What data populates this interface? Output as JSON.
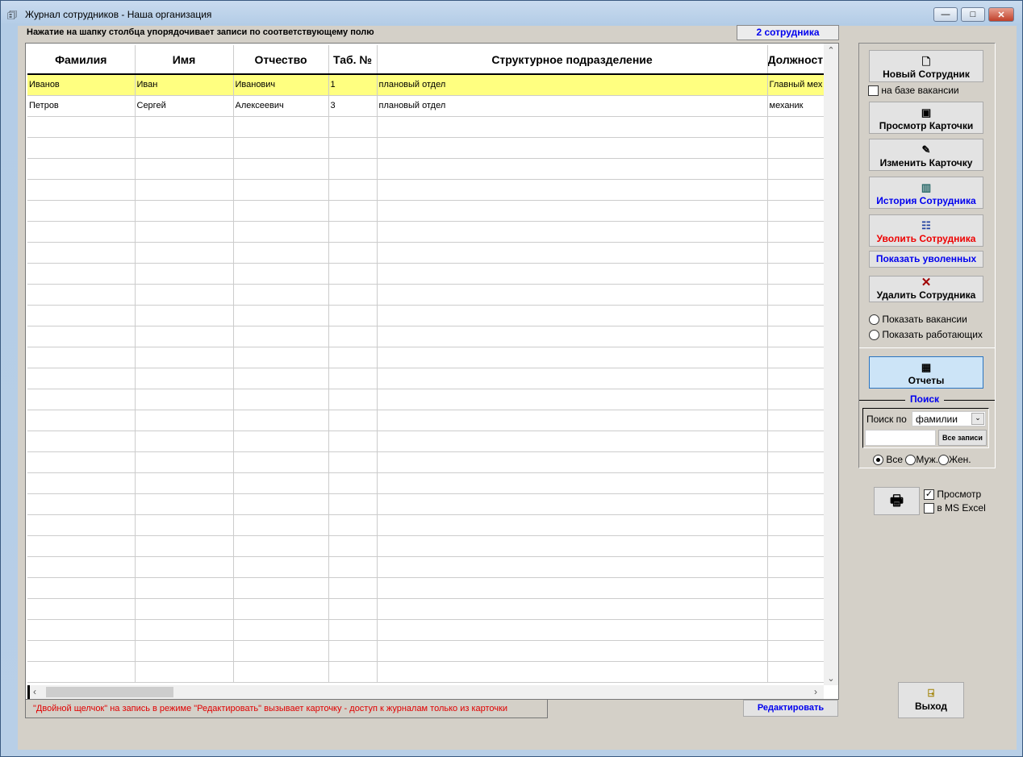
{
  "window": {
    "title": "Журнал сотрудников -  Наша организация",
    "min": "—",
    "max": "□",
    "close": "✕"
  },
  "hint": "Нажатие на шапку столбца упорядочивает записи  по соответствующему полю",
  "count": "2 сотрудника",
  "table": {
    "columns": [
      "Фамилия",
      "Имя",
      "Отчество",
      "Таб. №",
      "Структурное подразделение",
      "Должност"
    ],
    "rows": [
      [
        "Иванов",
        "Иван",
        "Иванович",
        "1",
        "плановый отдел",
        "Главный мех"
      ],
      [
        "Петров",
        "Сергей",
        "Алексеевич",
        "3",
        "плановый отдел",
        "механик"
      ]
    ],
    "selected_row": 0
  },
  "status": "\"Двойной щелчок\" на запись в режиме \"Редактировать\" вызывает карточку  -  доступ к журналам только из карточки",
  "edit_button": "Редактировать",
  "exit_button": "Выход",
  "panel": {
    "new_employee": "Новый Сотрудник",
    "from_vacancy": "на базе вакансии",
    "view_card": "Просмотр Карточки",
    "edit_card": "Изменить Карточку",
    "history": "История Сотрудника",
    "dismiss": "Уволить Сотрудника",
    "show_dismissed": "Показать уволенных",
    "delete": "Удалить Сотрудника",
    "show_vacancies": "Показать вакансии",
    "show_working": "Показать работающих",
    "reports": "Отчеты",
    "search": {
      "title": "Поиск",
      "by_label": "Поиск по",
      "by_value": "фамилии",
      "query": "",
      "all_records": "Все записи",
      "gender": [
        "Все",
        "Муж.",
        "Жен."
      ],
      "gender_selected": "Все"
    },
    "print": {
      "preview": "Просмотр",
      "preview_checked": true,
      "excel": "в MS Excel",
      "excel_checked": false
    }
  },
  "colors": {
    "selected_row": "#ffff80",
    "blue_text": "#0000ee",
    "red_text": "#ee0000",
    "client_bg": "#d4d0c8"
  }
}
